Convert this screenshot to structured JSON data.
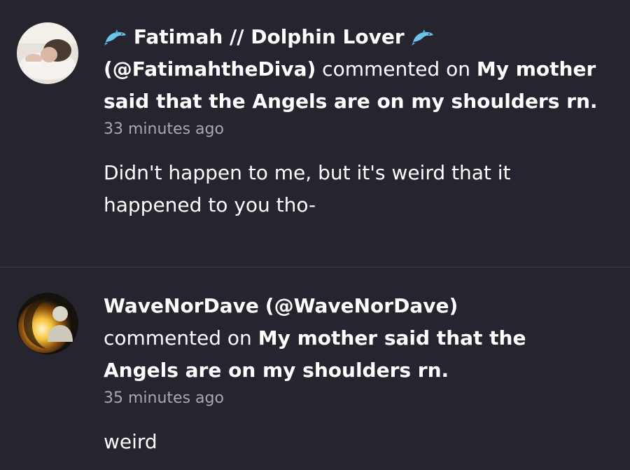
{
  "notifications": [
    {
      "user_display": "Fatimah // Dolphin Lover",
      "handle": "(@FatimahtheDiva)",
      "action": "commented on",
      "post_title": "My mother said that the Angels are on my shoulders rn.",
      "time": "33 minutes ago",
      "comment": "Didn't happen to me, but it's weird that it happened to you tho-",
      "avatar_icon": "user-photo-avatar",
      "name_icons": [
        "dolphin-icon",
        "dolphin-icon"
      ]
    },
    {
      "user_display": "WaveNorDave",
      "handle": "(@WaveNorDave)",
      "action": "commented on",
      "post_title": "My mother said that the Angels are on my shoulders rn.",
      "time": "35 minutes ago",
      "comment": "weird",
      "avatar_icon": "glowing-avatar"
    }
  ],
  "colors": {
    "background": "#25242f",
    "divider": "#3b3a46",
    "text": "#ffffff",
    "muted": "#a9a8b2",
    "dolphin": "#6ec3e8"
  }
}
